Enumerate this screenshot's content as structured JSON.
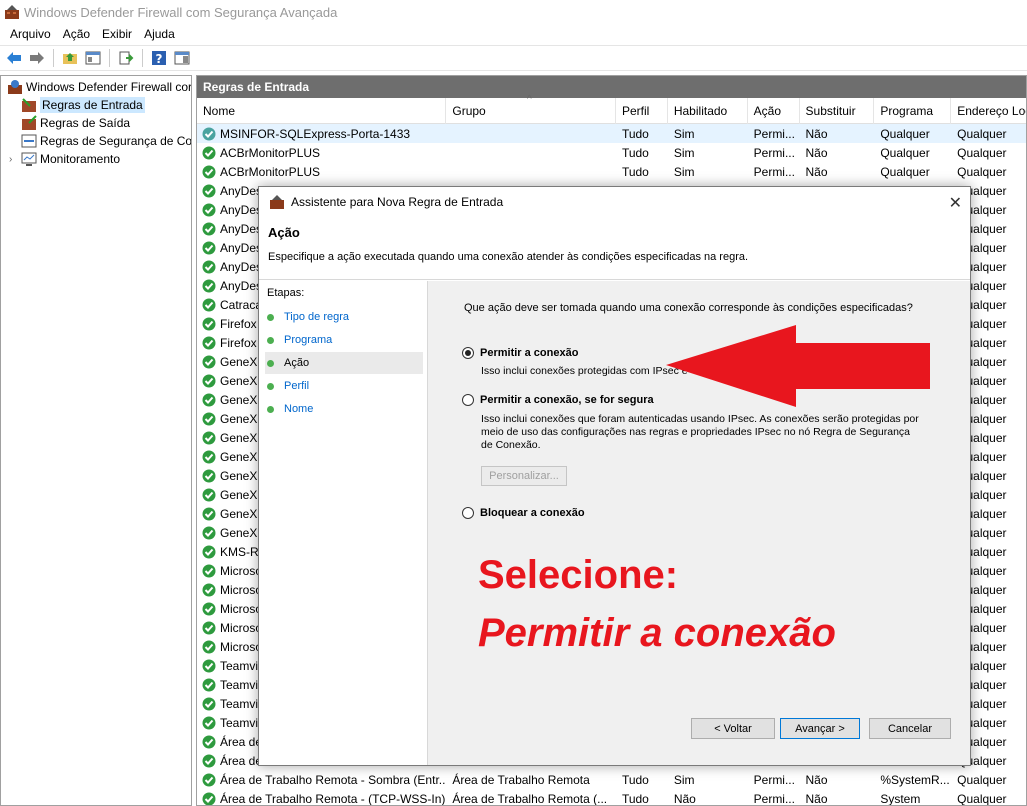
{
  "window": {
    "title": "Windows Defender Firewall com Segurança Avançada"
  },
  "menu": [
    "Arquivo",
    "Ação",
    "Exibir",
    "Ajuda"
  ],
  "tree": {
    "root": "Windows Defender Firewall cor",
    "items": [
      "Regras de Entrada",
      "Regras de Saída",
      "Regras de Segurança de Co",
      "Monitoramento"
    ]
  },
  "pane": {
    "title": "Regras de Entrada"
  },
  "columns": [
    "Nome",
    "Grupo",
    "Perfil",
    "Habilitado",
    "Ação",
    "Substituir",
    "Programa",
    "Endereço Loc"
  ],
  "rows": [
    {
      "name": "MSINFOR-SQLExpress-Porta-1433",
      "group": "",
      "profile": "Tudo",
      "enabled": "Sim",
      "action": "Permi...",
      "override": "Não",
      "program": "Qualquer",
      "local": "Qualquer"
    },
    {
      "name": "ACBrMonitorPLUS",
      "group": "",
      "profile": "Tudo",
      "enabled": "Sim",
      "action": "Permi...",
      "override": "Não",
      "program": "Qualquer",
      "local": "Qualquer"
    },
    {
      "name": "ACBrMonitorPLUS",
      "group": "",
      "profile": "Tudo",
      "enabled": "Sim",
      "action": "Permi...",
      "override": "Não",
      "program": "Qualquer",
      "local": "Qualquer"
    },
    {
      "name": "AnyDes",
      "local": "Qualquer"
    },
    {
      "name": "AnyDes",
      "local": "Qualquer"
    },
    {
      "name": "AnyDes",
      "local": "Qualquer"
    },
    {
      "name": "AnyDes",
      "local": "Qualquer"
    },
    {
      "name": "AnyDes",
      "local": "Qualquer"
    },
    {
      "name": "AnyDes",
      "local": "Qualquer"
    },
    {
      "name": "Catraca",
      "local": "Qualquer"
    },
    {
      "name": "Firefox",
      "local": "Qualquer"
    },
    {
      "name": "Firefox",
      "local": "Qualquer"
    },
    {
      "name": "GeneXu",
      "local": "Qualquer"
    },
    {
      "name": "GeneXu",
      "local": "Qualquer"
    },
    {
      "name": "GeneXu",
      "local": "Qualquer"
    },
    {
      "name": "GeneXu",
      "local": "Qualquer"
    },
    {
      "name": "GeneXu",
      "local": "Qualquer"
    },
    {
      "name": "GeneXu",
      "local": "Qualquer"
    },
    {
      "name": "GeneXu",
      "local": "Qualquer"
    },
    {
      "name": "GeneXu",
      "local": "Qualquer"
    },
    {
      "name": "GeneXu",
      "local": "Qualquer"
    },
    {
      "name": "GeneXu",
      "local": "Qualquer"
    },
    {
      "name": "KMS-R",
      "local": "Qualquer"
    },
    {
      "name": "Microso",
      "local": "Qualquer"
    },
    {
      "name": "Microso",
      "local": "Qualquer"
    },
    {
      "name": "Microso",
      "local": "Qualquer"
    },
    {
      "name": "Microso",
      "local": "Qualquer"
    },
    {
      "name": "Microso",
      "local": "Qualquer"
    },
    {
      "name": "Teamvi",
      "local": "Qualquer"
    },
    {
      "name": "Teamvi",
      "local": "Qualquer"
    },
    {
      "name": "Teamvi",
      "local": "Qualquer"
    },
    {
      "name": "Teamvi",
      "local": "Qualquer"
    },
    {
      "name": "Área de",
      "local": "Qualquer"
    },
    {
      "name": "Área de",
      "local": "Qualquer"
    },
    {
      "name": "Área de Trabalho Remota - Sombra (Entr...",
      "group": "Área de Trabalho Remota",
      "profile": "Tudo",
      "enabled": "Sim",
      "action": "Permi...",
      "override": "Não",
      "program": "%SystemR...",
      "local": "Qualquer"
    },
    {
      "name": "Área de Trabalho Remota - (TCP-WSS-In)",
      "group": "Área de Trabalho Remota (...",
      "profile": "Tudo",
      "enabled": "Não",
      "action": "Permi...",
      "override": "Não",
      "program": "System",
      "local": "Qualquer"
    }
  ],
  "dialog": {
    "title": "Assistente para Nova Regra de Entrada",
    "heading": "Ação",
    "subheading": "Especifique a ação executada quando uma conexão atender às condições especificadas na regra.",
    "steps_label": "Etapas:",
    "steps": [
      "Tipo de regra",
      "Programa",
      "Ação",
      "Perfil",
      "Nome"
    ],
    "question": "Que ação deve ser tomada quando uma conexão corresponde às condições especificadas?",
    "option1": {
      "label": "Permitir a conexão",
      "desc": "Isso inclui conexões protegidas com IPsec e"
    },
    "option2": {
      "label": "Permitir a conexão, se for segura",
      "desc": "Isso inclui conexões que foram autenticadas usando IPsec. As conexões serão protegidas por meio de uso das configurações nas regras e propriedades IPsec no nó Regra de Segurança de Conexão."
    },
    "customize": "Personalizar...",
    "option3": {
      "label": "Bloquear a conexão"
    },
    "back": "< Voltar",
    "next": "Avançar >",
    "cancel": "Cancelar",
    "callout_line1": "Selecione:",
    "callout_line2": "Permitir a conexão"
  },
  "colors": {
    "accent_red": "#e8161e",
    "selection": "#cce8ff",
    "header_gray": "#6e6e6e"
  }
}
